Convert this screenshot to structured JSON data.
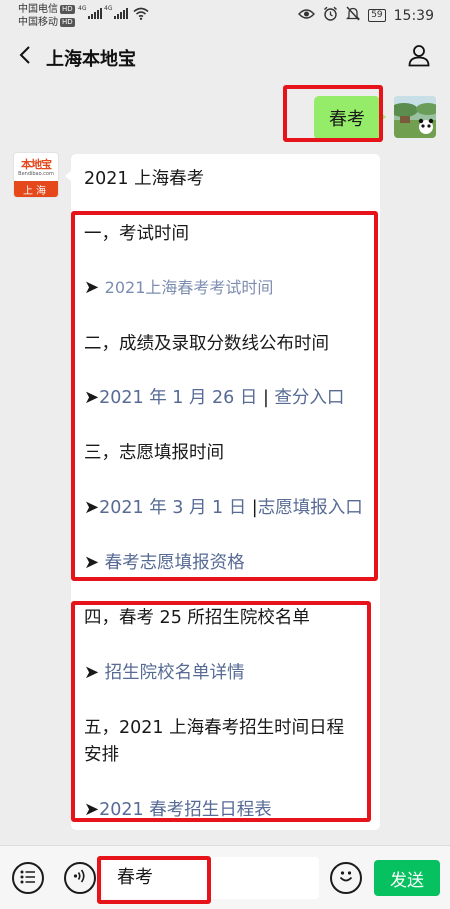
{
  "status_bar": {
    "carrier1": "中国电信",
    "carrier2": "中国移动",
    "hd": "HD",
    "net1": "4G",
    "net2": "4G",
    "battery": "59",
    "time": "15:39"
  },
  "nav": {
    "title": "上海本地宝"
  },
  "outgoing": {
    "text": "春考"
  },
  "bot_avatar": {
    "logo_text": "本地宝",
    "logo_sub": "Bendibao.com",
    "city": "上海"
  },
  "message": {
    "heading": "2021 上海春考",
    "section1_title": "一，考试时间",
    "link1": "2021上海春考考试时间",
    "section2_title": "二，成绩及录取分数线公布时间",
    "link2_date": "2021 年 1 月 26 日",
    "link2_action": "查分入口",
    "section3_title": "三，志愿填报时间",
    "link3_date": "2021 年 3 月 1 日",
    "link3_action": "志愿填报入口",
    "link4": "春考志愿填报资格",
    "section4_title": "四，春考 25 所招生院校名单",
    "link5": "招生院校名单详情",
    "section5_title_line1": "五，2021 上海春考招生时间日程",
    "section5_title_line2": "安排",
    "link6": "2021 春考招生日程表",
    "arrow": "➤",
    "separator": "|"
  },
  "input_bar": {
    "input_value": "春考",
    "send_label": "发送"
  },
  "colors": {
    "accent_green": "#07c160",
    "bubble_green": "#95ec69",
    "link_blue": "#576b95",
    "highlight_red": "#e6131a",
    "brand_orange": "#e4481b"
  }
}
